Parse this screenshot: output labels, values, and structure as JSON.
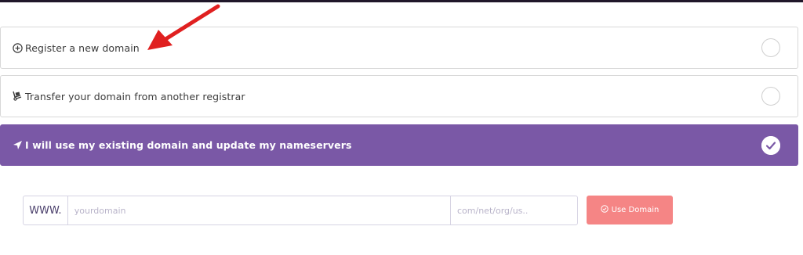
{
  "options": [
    {
      "label": "Register a new domain",
      "icon": "plus-circle-icon",
      "selected": false
    },
    {
      "label": "Transfer your domain from another registrar",
      "icon": "transfer-dolly-icon",
      "selected": false
    },
    {
      "label": "I will use my existing domain and update my nameservers",
      "icon": "location-arrow-icon",
      "selected": true
    }
  ],
  "domain_form": {
    "prefix": "WWW.",
    "domain_placeholder": "yourdomain",
    "tld_placeholder": "com/net/org/us..",
    "submit_label": "Use Domain",
    "submit_icon": "check-circle-icon"
  },
  "colors": {
    "selected_row": "#7a58a6",
    "button": "#f58585",
    "arrow": "#e02020"
  }
}
